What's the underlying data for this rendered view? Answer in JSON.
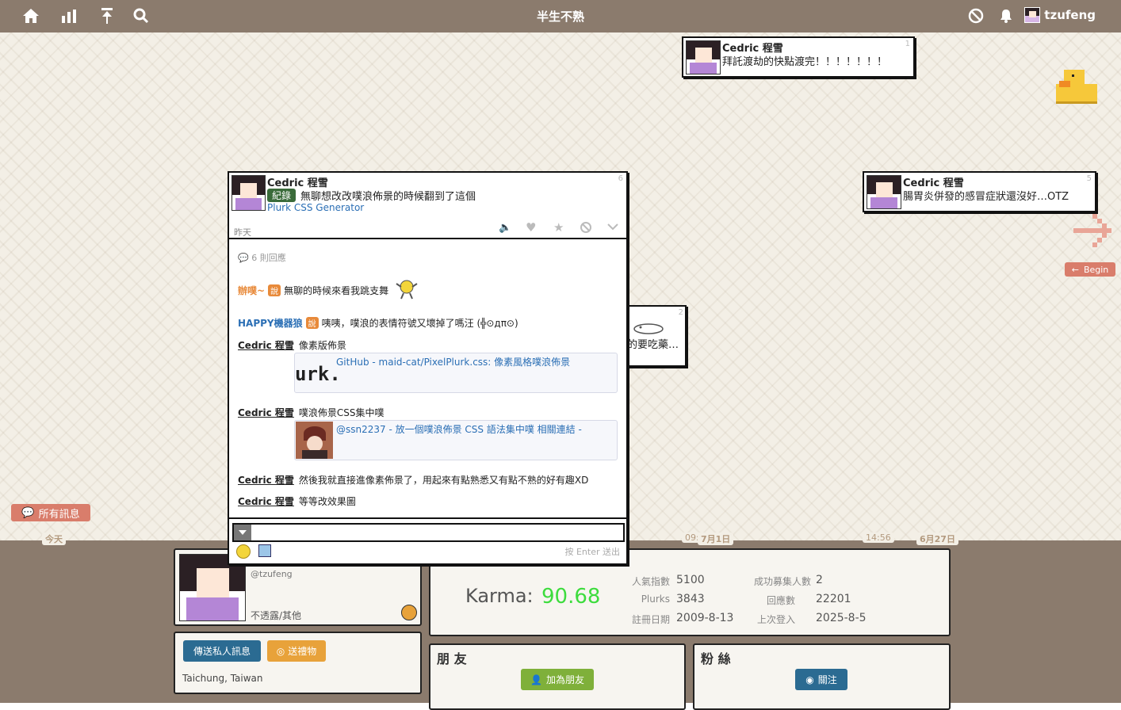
{
  "app": {
    "title": "半生不熟",
    "user": "tzufeng"
  },
  "timeline": {
    "plurk_top": {
      "author": "Cedric 程雪",
      "text": "拜託渡劫的快點渡完！！！！！！！",
      "count": "1"
    },
    "plurk_right": {
      "author": "Cedric 程雪",
      "text": "腸胃炎併發的感冒症狀還沒好…OTZ",
      "count": "5"
    },
    "plurk_mid": {
      "text": "的要吃藥…",
      "count": "2"
    },
    "begin_label": "Begin",
    "all_messages": "所有訊息",
    "today": "今天",
    "date_jul1": "7月1日",
    "date_jun27": "6月27日",
    "time_1": "09:",
    "time_2": "14:56"
  },
  "main_plurk": {
    "author": "Cedric 程雪",
    "qualifier": "紀錄",
    "text": "無聊想改改噗浪佈景的時候翻到了這個",
    "link": "Plurk CSS Generator",
    "count": "6",
    "time": "昨天",
    "response_count": "6 則回應",
    "responses": [
      {
        "author": "辦噗~",
        "qualifier": "說",
        "text": "無聊的時候來看我跳支舞"
      },
      {
        "author": "HAPPY機器狼",
        "qualifier": "說",
        "text": "咦咦，噗浪的表情符號又壞掉了嗎汪 (╬⊙дπ⊙)"
      },
      {
        "author": "Cedric 程雪",
        "text": "像素版佈景",
        "card_thumb": "urk.",
        "card_text": "GitHub - maid-cat/PixelPlurk.css: 像素風格噗浪佈景"
      },
      {
        "author": "Cedric 程雪",
        "text": "噗浪佈景CSS集中噗",
        "card_text": "@ssn2237 - 放一個噗浪佈景 CSS 語法集中噗 相關連結 -"
      },
      {
        "author": "Cedric 程雪",
        "text": "然後我就直接進像素佈景了，用起來有點熟悉又有點不熟的好有趣XD"
      },
      {
        "author": "Cedric 程雪",
        "text": "等等改效果圖"
      }
    ],
    "input_hint": "按 Enter 送出"
  },
  "profile": {
    "handle": "@tzufeng",
    "relationship": "不透露/其他",
    "send_private": "傳送私人訊息",
    "send_gift": "送禮物",
    "location": "Taichung, Taiwan"
  },
  "stats": {
    "karma_label": "Karma:",
    "karma_value": "90.68",
    "popularity_label": "人氣指數",
    "popularity": "5100",
    "recruit_label": "成功募集人數",
    "recruit": "2",
    "plurks_label": "Plurks",
    "plurks": "3843",
    "replies_label": "回應數",
    "replies": "22201",
    "registered_label": "註冊日期",
    "registered": "2009-8-13",
    "last_login_label": "上次登入",
    "last_login": "2025-8-5"
  },
  "friends": {
    "title": "朋 友",
    "add_button": "加為朋友"
  },
  "fans": {
    "title": "粉 絲",
    "follow_button": "關注"
  },
  "colors": {
    "topbar": "#8b7b6d",
    "accent_green": "#7fb03a",
    "accent_blue": "#2b6b92",
    "accent_orange": "#e8a23a",
    "karma": "#3ddc3d",
    "link": "#2b6fb5"
  }
}
